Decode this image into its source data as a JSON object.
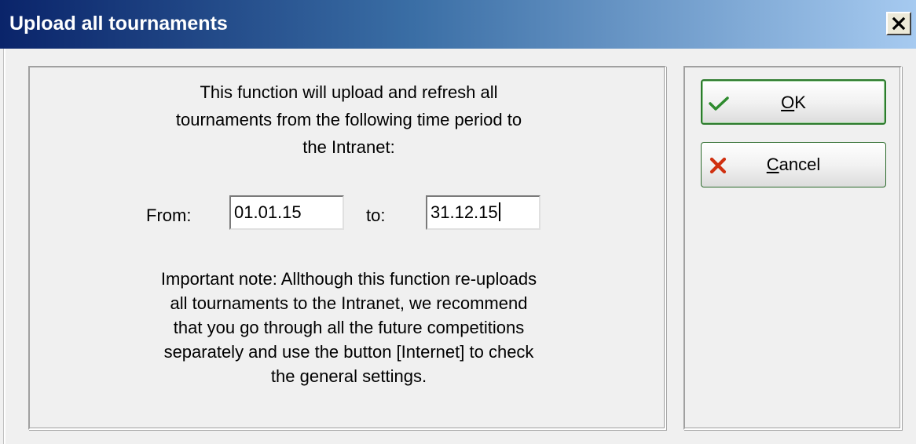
{
  "window": {
    "title": "Upload all tournaments",
    "close_icon": "close-icon"
  },
  "intro": {
    "lines": [
      "This function will upload and refresh all",
      "tournaments from the following time period to",
      "the Intranet:"
    ]
  },
  "period": {
    "from_label": "From:",
    "from_value": "01.01.15",
    "to_label": "to:",
    "to_value": "31.12.15"
  },
  "note": {
    "lines": [
      "Important note: Allthough this function re-uploads",
      "all tournaments to the Intranet, we recommend",
      "that you go through all the future competitions",
      "separately and use the button [Internet] to check",
      "the general settings."
    ]
  },
  "buttons": {
    "ok": {
      "mnemonic": "O",
      "rest": "K",
      "icon": "checkmark-icon",
      "color": "#2e8b2e"
    },
    "cancel": {
      "mnemonic": "C",
      "rest": "ancel",
      "icon": "cross-icon",
      "color": "#d03010"
    }
  },
  "colors": {
    "titlebar_start": "#0a246a",
    "titlebar_end": "#a6caf0",
    "background": "#f0f0f0"
  }
}
